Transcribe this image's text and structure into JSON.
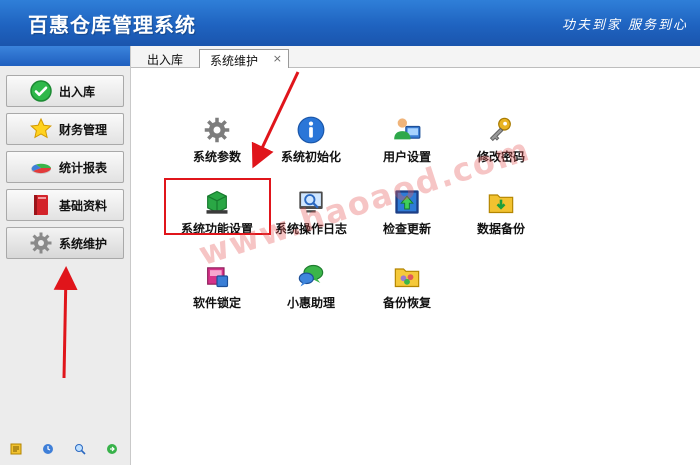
{
  "header": {
    "app_title": "百惠仓库管理系统",
    "slogan": "功夫到家 服务到心"
  },
  "sidebar": {
    "items": [
      {
        "label": "出入库",
        "icon": "check-circle-icon"
      },
      {
        "label": "财务管理",
        "icon": "star-icon"
      },
      {
        "label": "统计报表",
        "icon": "pie-chart-icon"
      },
      {
        "label": "基础资料",
        "icon": "book-icon"
      },
      {
        "label": "系统维护",
        "icon": "gear-icon"
      }
    ],
    "bottom_icons": [
      "note-icon",
      "clock-icon",
      "search-icon",
      "exit-icon"
    ]
  },
  "tabs": [
    {
      "label": "出入库"
    },
    {
      "label": "系统维护",
      "close": "×"
    }
  ],
  "tiles": [
    {
      "label": "系统参数",
      "icon": "gear-icon"
    },
    {
      "label": "系统初始化",
      "icon": "info-icon"
    },
    {
      "label": "用户设置",
      "icon": "user-icon"
    },
    {
      "label": "修改密码",
      "icon": "key-icon"
    },
    {
      "label": "系统功能设置",
      "icon": "function-settings-icon"
    },
    {
      "label": "系统操作日志",
      "icon": "log-icon"
    },
    {
      "label": "检查更新",
      "icon": "update-icon"
    },
    {
      "label": "数据备份",
      "icon": "backup-folder-icon"
    },
    {
      "label": "软件锁定",
      "icon": "lock-icon"
    },
    {
      "label": "小惠助理",
      "icon": "chat-assistant-icon"
    },
    {
      "label": "备份恢复",
      "icon": "restore-folder-icon"
    }
  ],
  "watermark": "www.haoaod.com",
  "colors": {
    "title_bar": "#1f63c0",
    "highlight": "#e0151b",
    "arrow": "#e0151b"
  }
}
